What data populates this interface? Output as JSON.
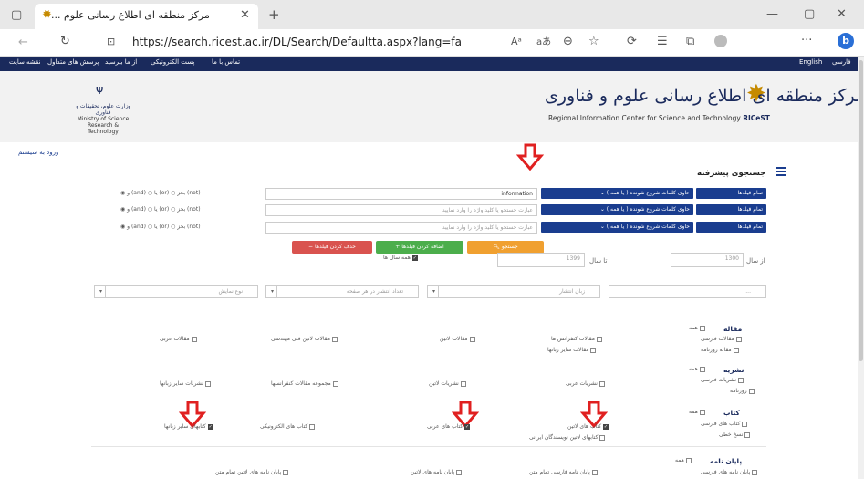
{
  "browser": {
    "tab_title": "مرکز منطقه ای اطلاع رسانی علوم ...",
    "url": "https://search.ricest.ac.ir/DL/Search/Defaultta.aspx?lang=fa",
    "reader_label": "À̶",
    "read_aloud_label": "aあ"
  },
  "site_nav": {
    "right": [
      "فارسی",
      "English"
    ],
    "left": [
      "نقشه سایت",
      "پرسش های متداول",
      "از ما بپرسید",
      "پست الکترونیکی",
      "تماس با ما"
    ]
  },
  "banner": {
    "title": "مرکز منطقه ای اطلاع رسانی علوم و فناوری",
    "subtitle_prefix": "Regional Information Center for Science and Technology",
    "subtitle_brand": "RICeST",
    "ministry_fa": "وزارت علوم، تحقیقات و فناوری",
    "ministry_en_1": "Ministry of Science",
    "ministry_en_2": "Research & Technology"
  },
  "login": "ورود به سیستم",
  "page_title": "جستجوی پیشرفته",
  "rows": [
    {
      "field": "تمام فیلدها",
      "match": "حاوی کلمات شروع شونده ( یا همه )",
      "value": "information",
      "placeholder": "",
      "ops": "(not) بجز ○ (or) یا ○ (and) و ◉"
    },
    {
      "field": "تمام فیلدها",
      "match": "حاوی کلمات شروع شونده ( یا همه )",
      "value": "",
      "placeholder": "عبارت جستجو یا کلید واژه را وارد نمایید",
      "ops": "(not) بجز ○ (or) یا ○ (and) و ◉"
    },
    {
      "field": "تمام فیلدها",
      "match": "حاوی کلمات شروع شونده ( یا همه )",
      "value": "",
      "placeholder": "عبارت جستجو یا کلید واژه را وارد نمایید",
      "ops": "(not) بجز ○ (or) یا ○ (and) و ◉"
    }
  ],
  "buttons": {
    "search": "جستجو",
    "add_fields": "اضافه کردن فیلدها",
    "remove_fields": "حذف کردن فیلدها"
  },
  "years": {
    "from_label": "از سال",
    "from_placeholder": "1300",
    "to_label": "تا سال",
    "to_placeholder": "1399",
    "all_years": "همه سال ها"
  },
  "filters": [
    "...",
    "زبان انتشار",
    "تعداد انتشار در هر صفحه",
    "نوع نمایش"
  ],
  "sections": [
    {
      "title": "مقاله",
      "all": "همه",
      "col1": [
        "مقالات فارسی",
        "مقاله روزنامه"
      ],
      "col2": [
        "مقالات کنفرانس ها",
        "مقالات سایر زبانها"
      ],
      "col3": [
        "مقالات لاتین"
      ],
      "col4": [
        "مقالات لاتین فنی مهندسی"
      ],
      "col5": [
        "مقالات عربی"
      ]
    },
    {
      "title": "نشریه",
      "all": "همه",
      "col1": [
        "نشریات فارسی",
        "روزنامه"
      ],
      "col2": [
        "نشریات عربی"
      ],
      "col3": [
        "نشریات لاتین"
      ],
      "col4": [
        "مجموعه مقالات کنفرانسها"
      ],
      "col5": [
        "نشریات سایر زبانها"
      ]
    },
    {
      "title": "کتاب",
      "all": "همه",
      "col1": [
        "کتاب های فارسی",
        "نسخ خطی"
      ],
      "col2": [
        "کتاب های لاتین",
        "کتابهای لاتین نویسندگان ایرانی"
      ],
      "col3": [
        "کتاب های عربی"
      ],
      "col4": [
        "کتاب های الکترونیکی"
      ],
      "col5": [
        "کتابهای سایر زبانها"
      ]
    },
    {
      "title": "پایان نامه",
      "all": "همه",
      "col1": [
        "پایان نامه های فارسی"
      ],
      "col2": [
        "پایان نامه فارسی تمام متن"
      ],
      "col3": [
        "پایان نامه های لاتین"
      ],
      "col4": [
        "پایان نامه های لاتین تمام متن"
      ],
      "col5": []
    }
  ],
  "colors": {
    "navy": "#1a2a5c",
    "blue_button": "#1a3d8f",
    "orange": "#f0a030",
    "green": "#4cae4c",
    "red": "#d9534f",
    "annotation_arrow": "#e02020"
  }
}
